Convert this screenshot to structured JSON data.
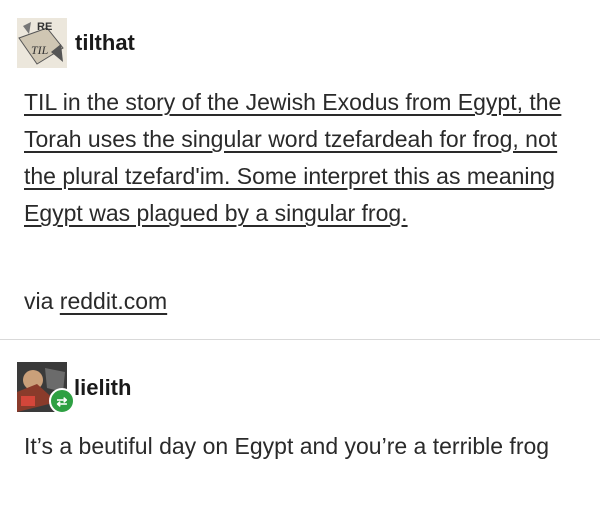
{
  "post": {
    "username": "tilthat",
    "avatar_text_top": "RE",
    "avatar_text_mid": "TIL",
    "body": "TIL in the story of the Jewish Exodus from Egypt, the Torah uses the singular word tzefardeah for frog, not the plural tzefard'im. Some interpret this as meaning Egypt was plagued by a singular frog.",
    "via_prefix": "via",
    "via_link": "reddit.com"
  },
  "reply": {
    "username": "lielith",
    "badge_icon": "reblog-icon",
    "text": "It’s a beutiful day on Egypt and you’re a terrible frog"
  }
}
